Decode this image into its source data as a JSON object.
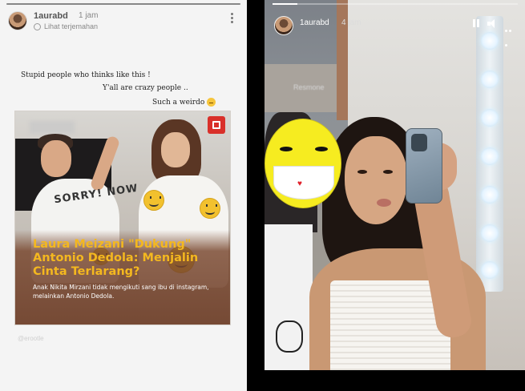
{
  "left_story": {
    "username": "1aurabd",
    "time": "1 jam",
    "translate_label": "Lihat terjemahan",
    "captions": [
      "Stupid people who thinks like this !",
      "Y'all are crazy people ..",
      "Such a weirdo"
    ],
    "article": {
      "headline": "Laura Meizani \"Dukung\" Antonio Dedola: Menjalin Cinta Terlarang?",
      "subtext": "Anak Nikita Mirzani tidak mengikuti sang ibu di instagram, melainkan Antonio Dedola.",
      "shirt_text": "SORRY! NOW"
    },
    "watermark": "@erootle"
  },
  "right_story": {
    "username": "1aurabd",
    "time": "4 jam",
    "background_sign": "Resmone"
  },
  "colors": {
    "headline_yellow": "#f4b81f",
    "overlay_brown": "#6e3e28",
    "badge_red": "#d9302a",
    "sticker_yellow": "#f6ec20"
  },
  "icons": [
    "avatar",
    "globe-icon",
    "more-vert-icon",
    "pause-icon",
    "volume-icon",
    "more-horiz-icon",
    "weirdo-emoji",
    "smiley-sticker",
    "heart"
  ]
}
